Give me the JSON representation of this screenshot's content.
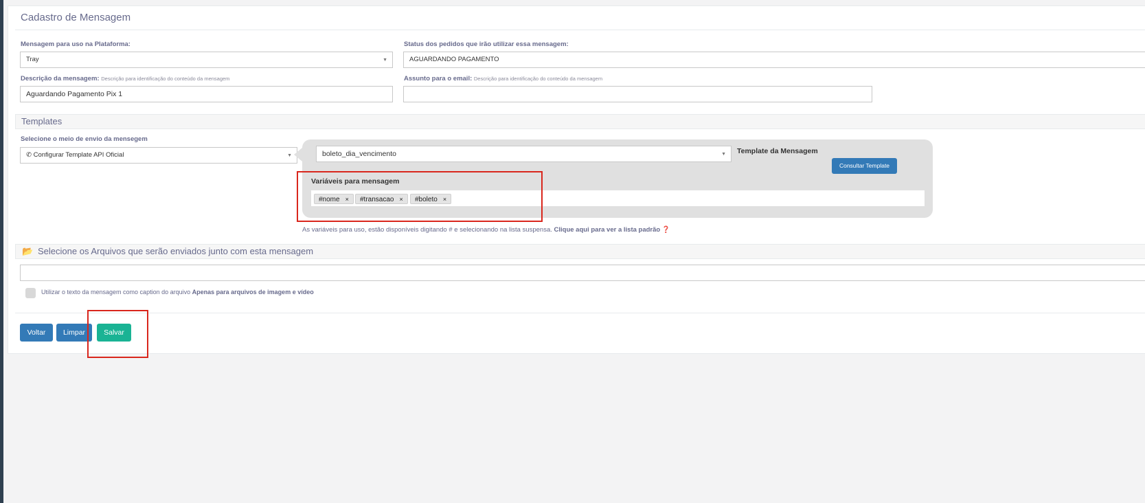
{
  "page": {
    "title": "Cadastro de Mensagem"
  },
  "platform": {
    "label": "Mensagem para uso na Plataforma:",
    "value": "Tray"
  },
  "status": {
    "label": "Status dos pedidos que irão utilizar essa mensagem:",
    "value": "AGUARDANDO PAGAMENTO"
  },
  "description": {
    "label": "Descrição da mensagem:",
    "hint": "Descrição para identificação do conteúdo da mensagem",
    "value": "Aguardando Pagamento Pix 1"
  },
  "subject": {
    "label": "Assunto para o email:",
    "hint": "Descrição para identificação do conteúdo da mensagem",
    "value": ""
  },
  "templates": {
    "heading": "Templates",
    "send_label": "Selecione o meio de envio da mensegem",
    "send_value": "Configurar Template API Oficial",
    "template_select_value": "boleto_dia_vencimento",
    "template_label": "Template da Mensagem",
    "consult_button": "Consultar Template",
    "variables_label": "Variáveis para mensagem",
    "variables": [
      "#nome",
      "#transacao",
      "#boleto"
    ],
    "remove_glyph": "×",
    "help_text_start": "As variáveis para uso, estão disponíveis digitando # e selecionando na lista suspensa.",
    "help_link": "Clique aqui para ver a lista padrão"
  },
  "files": {
    "heading": "Selecione os Arquivos que serão enviados junto com esta mensagem",
    "value": "",
    "caption_text": "Utilizar o texto da mensagem como caption do arquivo",
    "caption_strong": "Apenas para arquivos de imagem e vídeo",
    "caption_checked": false
  },
  "actions": {
    "back": "Voltar",
    "clear": "Limpar",
    "save": "Salvar"
  },
  "colors": {
    "primary": "#337ab7",
    "success": "#1ab394",
    "highlight": "#d9261c",
    "sidebar": "#2f4050"
  }
}
